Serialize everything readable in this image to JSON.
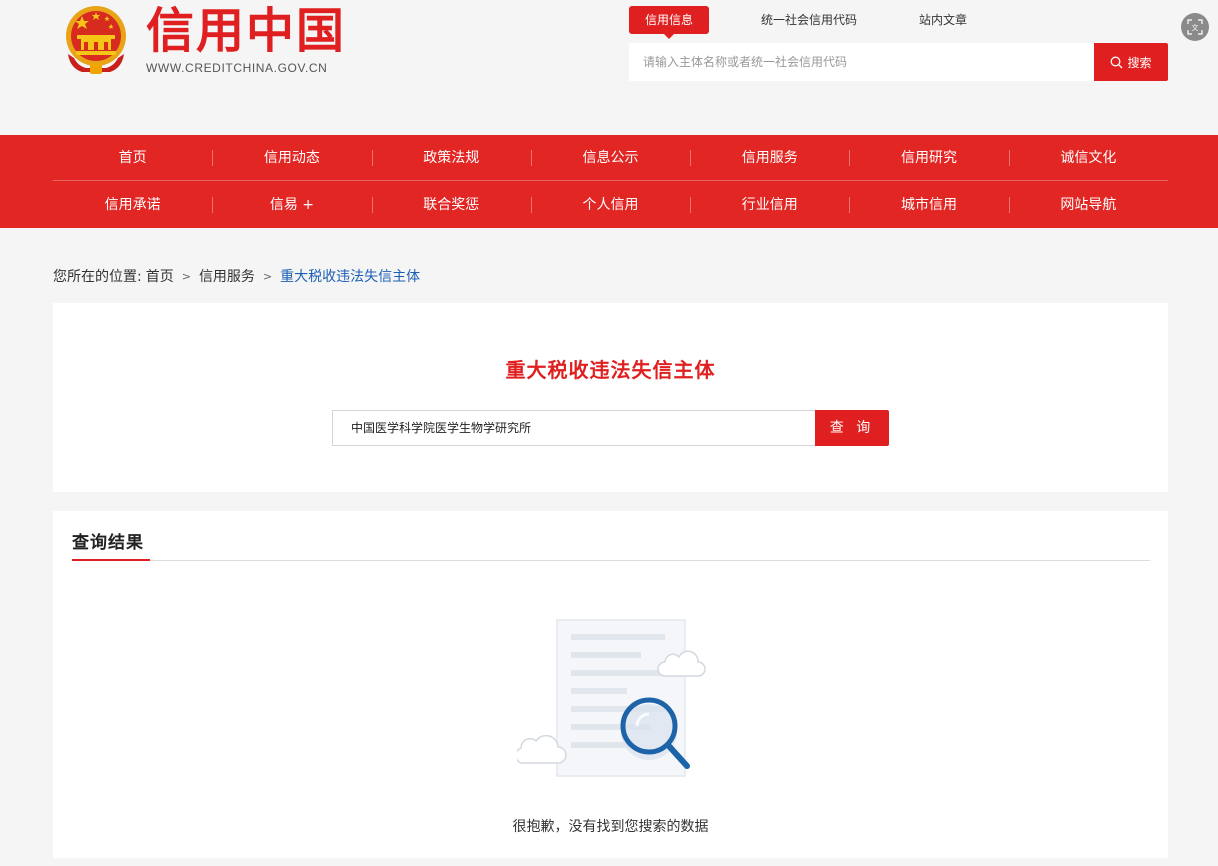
{
  "header": {
    "logo_title": "信用中国",
    "logo_url": "WWW.CREDITCHINA.GOV.CN",
    "search_tabs": [
      "信用信息",
      "统一社会信用代码",
      "站内文章"
    ],
    "search_placeholder": "请输入主体名称或者统一社会信用代码",
    "search_button": "搜索"
  },
  "nav": {
    "row1": [
      "首页",
      "信用动态",
      "政策法规",
      "信息公示",
      "信用服务",
      "信用研究",
      "诚信文化"
    ],
    "row2": [
      "信用承诺",
      "信易 +",
      "联合奖惩",
      "个人信用",
      "行业信用",
      "城市信用",
      "网站导航"
    ]
  },
  "breadcrumb": {
    "prefix": "您所在的位置:",
    "items": [
      "首页",
      "信用服务"
    ],
    "current": "重大税收违法失信主体",
    "separator": ">"
  },
  "query": {
    "title": "重大税收违法失信主体",
    "input_value": "中国医学科学院医学生物学研究所",
    "button": "查 询"
  },
  "results": {
    "title": "查询结果",
    "empty_message": "很抱歉，没有找到您搜索的数据"
  },
  "colors": {
    "brand_red": "#e02020",
    "nav_red": "#e22624",
    "link_blue": "#1a5fb4"
  }
}
